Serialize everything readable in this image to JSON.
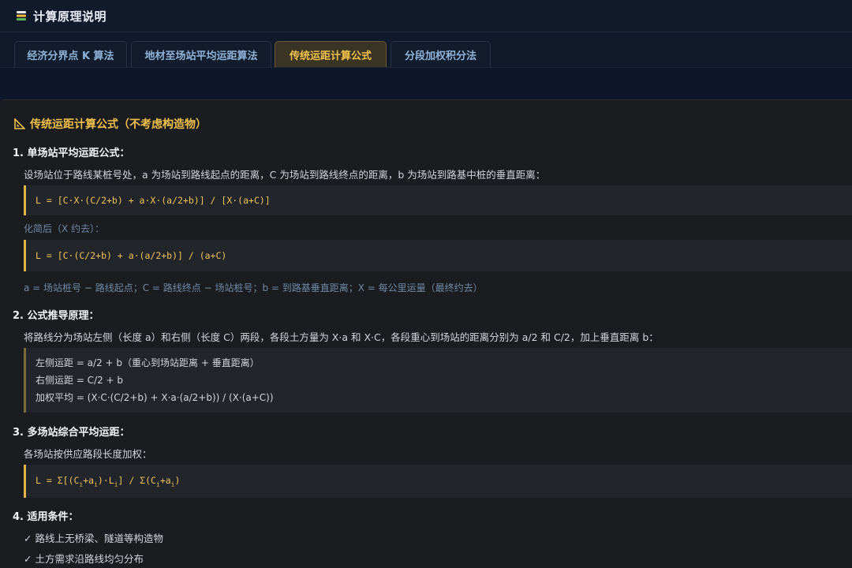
{
  "header": {
    "title": "计算原理说明",
    "icon": "book-stack-icon"
  },
  "tabs": [
    {
      "label": "经济分界点 K 算法",
      "active": false
    },
    {
      "label": "地材至场站平均运距算法",
      "active": false
    },
    {
      "label": "传统运距计算公式",
      "active": true
    },
    {
      "label": "分段加权积分法",
      "active": false
    }
  ],
  "content": {
    "section_icon": "triangle-ruler-icon",
    "section_title": "传统运距计算公式（不考虑构造物）",
    "s1": {
      "heading": "1. 单场站平均运距公式：",
      "desc": "设场站位于路线某桩号处，a 为场站到路线起点的距离，C 为场站到路线终点的距离，b 为场站到路基中桩的垂直距离：",
      "formula1": "L = [C·X·(C/2+b) + a·X·(a/2+b)] / [X·(a+C)]",
      "simplify_label": "化简后（X 约去）：",
      "formula2": "L = [C·(C/2+b) + a·(a/2+b)] / (a+C)",
      "legend": "a = 场站桩号 − 路线起点；C = 路线终点 − 场站桩号；b = 到路基垂直距离；X = 每公里运量（最终约去）"
    },
    "s2": {
      "heading": "2. 公式推导原理：",
      "desc": "将路线分为场站左侧（长度 a）和右侧（长度 C）两段，各段土方量为 X·a 和 X·C，各段重心到场站的距离分别为 a/2 和 C/2，加上垂直距离 b：",
      "lines": [
        "左侧运距 = a/2 + b（重心到场站距离 + 垂直距离）",
        "右侧运距 = C/2 + b",
        "加权平均 = (X·C·(C/2+b) + X·a·(a/2+b)) / (X·(a+C))"
      ]
    },
    "s3": {
      "heading": "3. 多场站综合平均运距：",
      "desc": "各场站按供应路段长度加权：",
      "f_a": "L = Σ[(C",
      "f_sub1": "i",
      "f_b": "+a",
      "f_sub2": "i",
      "f_c": ")·L",
      "f_sub3": "i",
      "f_d": "] / Σ(C",
      "f_sub4": "i",
      "f_e": "+a",
      "f_sub5": "i",
      "f_f": ")"
    },
    "s4": {
      "heading": "4. 适用条件：",
      "items": [
        "✓ 路线上无桥梁、隧道等构造物",
        "✓ 土方需求沿路线均匀分布"
      ]
    }
  }
}
